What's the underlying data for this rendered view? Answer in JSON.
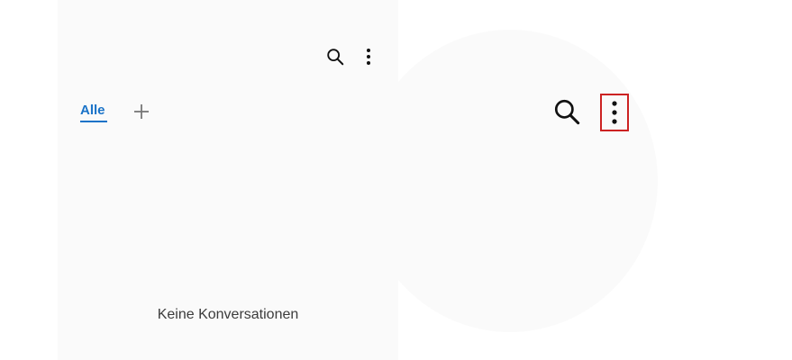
{
  "tabs": [
    {
      "label": "Alle",
      "selected": true
    }
  ],
  "icons": {
    "search": "search-icon",
    "more": "more-vert-icon",
    "add": "plus-icon"
  },
  "empty_state": {
    "message": "Keine Konversationen"
  },
  "colors": {
    "accent": "#1a73c8",
    "highlight": "#cc2222",
    "panel_background": "#fafafa"
  }
}
